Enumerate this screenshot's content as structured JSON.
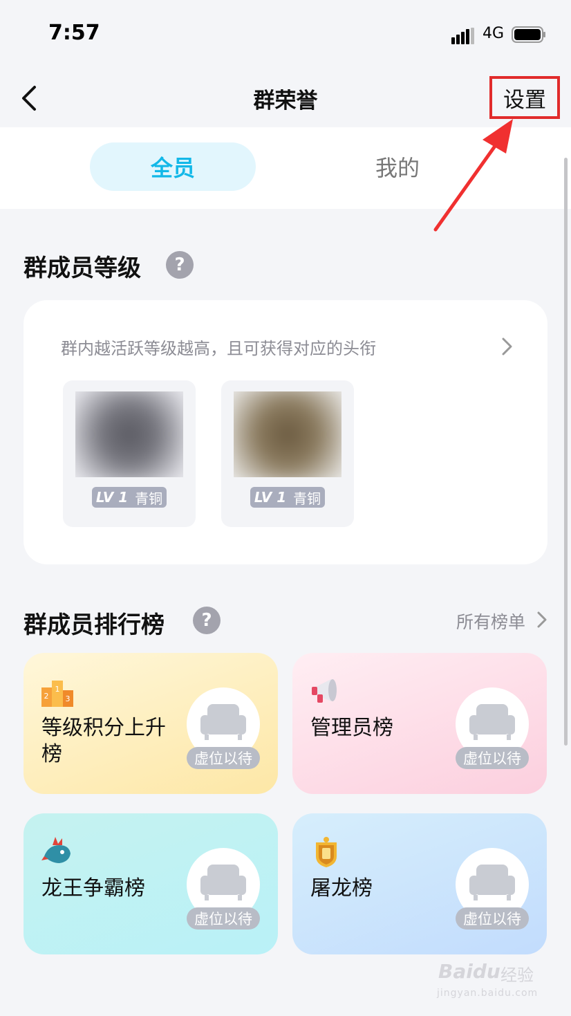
{
  "status_bar": {
    "time": "7:57",
    "network": "4G"
  },
  "nav": {
    "title": "群荣誉",
    "settings_label": "设置"
  },
  "tabs": [
    {
      "label": "全员",
      "selected": true
    },
    {
      "label": "我的",
      "selected": false
    }
  ],
  "member_level": {
    "title": "群成员等级",
    "help": "?",
    "description": "群内越活跃等级越高，且可获得对应的头衔",
    "members": [
      {
        "level": "LV 1",
        "rank": "青铜"
      },
      {
        "level": "LV 1",
        "rank": "青铜"
      }
    ]
  },
  "ranking": {
    "title": "群成员排行榜",
    "help": "?",
    "all_boards": "所有榜单",
    "boards": [
      {
        "name": "等级积分上升榜",
        "icon": "podium-icon",
        "seat_label": "虚位以待"
      },
      {
        "name": "管理员榜",
        "icon": "megaphone-icon",
        "seat_label": "虚位以待"
      },
      {
        "name": "龙王争霸榜",
        "icon": "dragon-icon",
        "seat_label": "虚位以待"
      },
      {
        "name": "屠龙榜",
        "icon": "dragon-badge-icon",
        "seat_label": "虚位以待"
      }
    ]
  },
  "watermark": {
    "brand": "Baidu",
    "brand_cn": "经验",
    "url": "jingyan.baidu.com"
  },
  "colors": {
    "accent": "#13b8e8",
    "highlight_box": "#e12b2b",
    "arrow": "#f03030"
  }
}
